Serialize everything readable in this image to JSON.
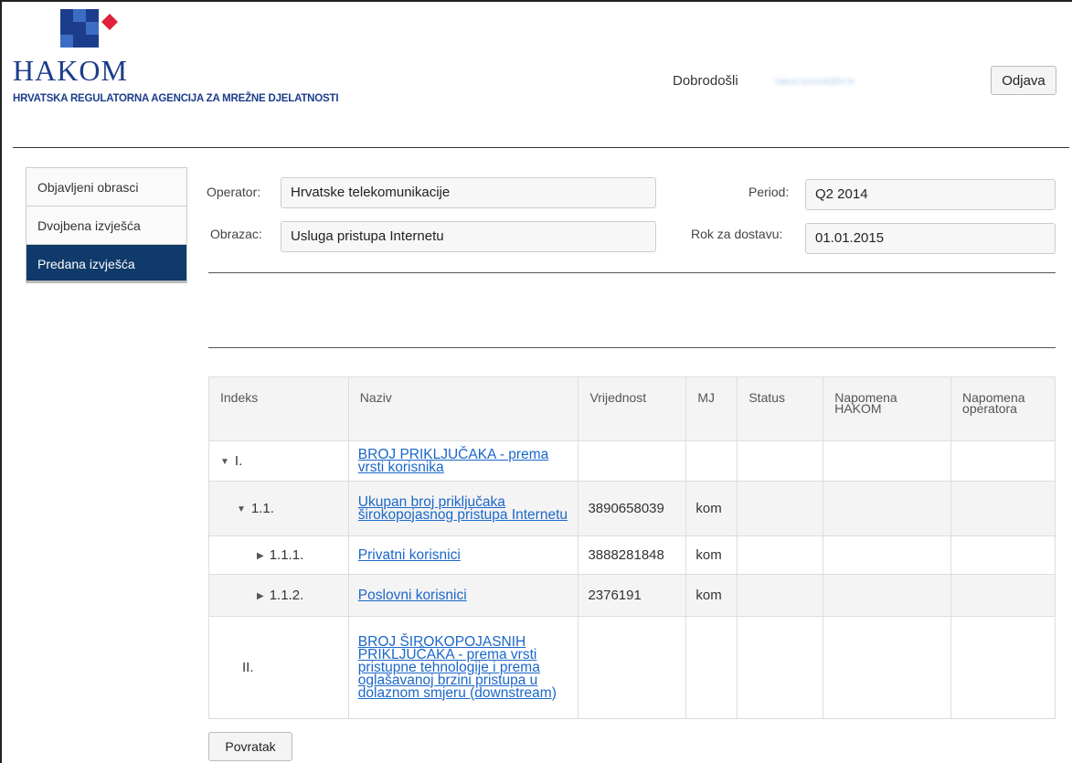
{
  "header": {
    "logo_text": "HAKOM",
    "logo_subtitle": "HRVATSKA REGULATORNA AGENCIJA ZA MREŽNE DJELATNOSTI",
    "welcome": "Dobrodošli",
    "user_email": "hakom.korisnik@ht.hr",
    "logout_label": "Odjava"
  },
  "sidebar": {
    "items": [
      {
        "label": "Objavljeni obrasci",
        "active": false
      },
      {
        "label": "Dvojbena izvješća",
        "active": false
      },
      {
        "label": "Predana izvješća",
        "active": true
      }
    ]
  },
  "form": {
    "operator_label": "Operator:",
    "operator_value": "Hrvatske telekomunikacije",
    "form_label": "Obrazac:",
    "form_value": "Usluga pristupa Internetu",
    "period_label": "Period:",
    "period_value": "Q2 2014",
    "deadline_label": "Rok za dostavu:",
    "deadline_value": "01.01.2015"
  },
  "table": {
    "headers": [
      "Indeks",
      "Naziv",
      "Vrijednost",
      "MJ",
      "Status",
      "Napomena HAKOM",
      "Napomena operatora"
    ],
    "rows": [
      {
        "index": "I.",
        "name": "BROJ PRIKLJUČAKA - prema vrsti korisnika",
        "value": "",
        "unit": "",
        "caret": "▼"
      },
      {
        "index": "1.1.",
        "name": "Ukupan broj priključaka širokopojasnog pristupa Internetu",
        "value": "3890658039",
        "unit": "kom",
        "caret": "▼"
      },
      {
        "index": "1.1.1.",
        "name": "Privatni korisnici",
        "value": "3888281848",
        "unit": "kom",
        "caret": "▶"
      },
      {
        "index": "1.1.2.",
        "name": "Poslovni korisnici",
        "value": "2376191",
        "unit": "kom",
        "caret": "▶"
      },
      {
        "index": "II.",
        "name": "BROJ ŠIROKOPOJASNIH PRIKLJUČAKA - prema vrsti pristupne tehnologije i prema oglašavanoj brzini pristupa u dolaznom smjeru (downstream)",
        "value": "",
        "unit": "",
        "caret": ""
      }
    ]
  },
  "back_label": "Povratak",
  "colors": {
    "brand_blue": "#1c3d8c",
    "active_nav": "#0f3a6a",
    "link": "#1b67c9",
    "logo_red": "#e2203b"
  }
}
